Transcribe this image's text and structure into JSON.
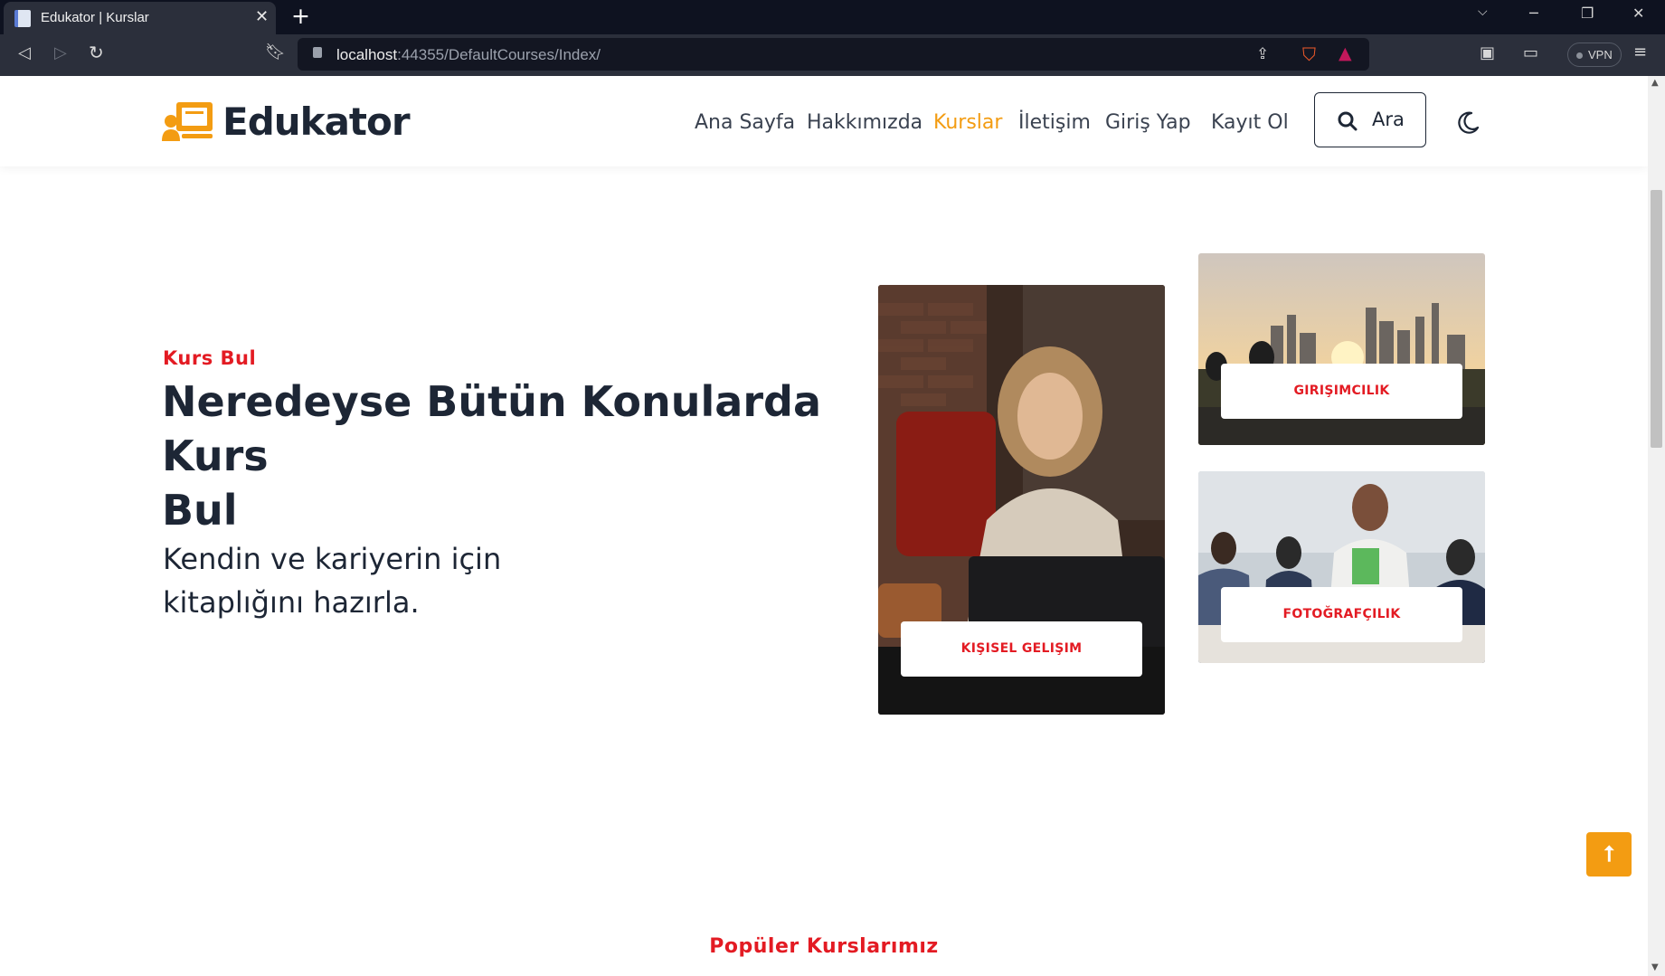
{
  "browser": {
    "tab_title": "Edukator | Kurslar",
    "url_host": "localhost",
    "url_rest": ":44355/DefaultCourses/Index/",
    "vpn_label": "VPN"
  },
  "header": {
    "logo_text": "Edukator",
    "nav": [
      "Ana Sayfa",
      "Hakkımızda",
      "Kurslar",
      "İletişim",
      "Giriş Yap",
      "Kayıt Ol"
    ],
    "active_nav": "Kurslar",
    "search_label": "Ara"
  },
  "hero": {
    "subtitle": "Kurs Bul",
    "title_bold_1": "Neredeyse Bütün Konularda",
    "title_regular": " Kurs",
    "title_bold_2": "Bul",
    "description": "Kendin ve kariyerin için kitaplığını hazırla."
  },
  "categories": [
    {
      "label": "KIŞISEL GELIŞIM"
    },
    {
      "label": "GIRIŞIMCILIK"
    },
    {
      "label": "FOTOĞRAFÇILIK"
    }
  ],
  "popular": {
    "subtitle": "Popüler Kurslarımız"
  },
  "colors": {
    "accent": "#f39c12",
    "red": "#e31b23",
    "dark": "#1d2635"
  },
  "icons": [
    "search-icon",
    "moon-icon",
    "arrow-up-icon",
    "logo-icon"
  ]
}
